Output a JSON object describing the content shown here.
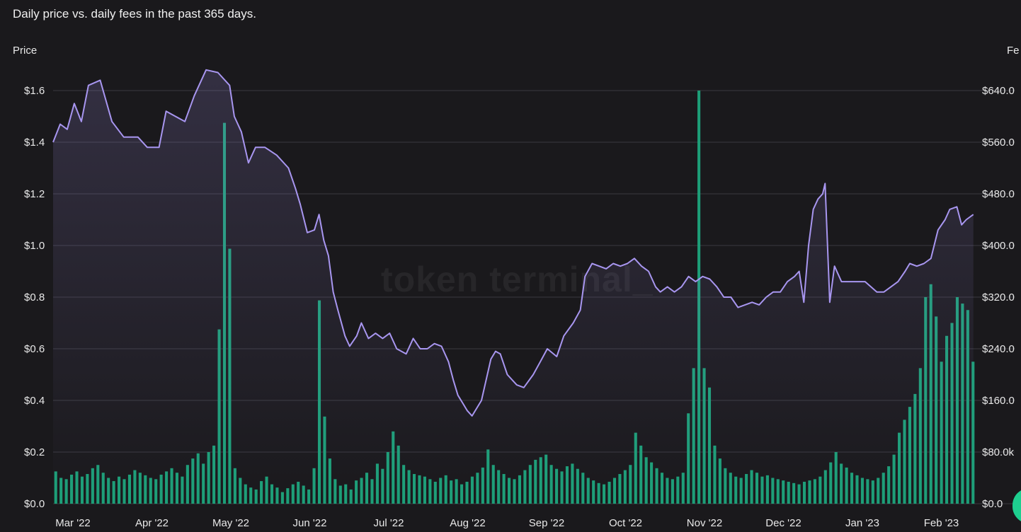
{
  "caption": "Daily price vs. daily fees in the past 365 days.",
  "watermark": "token terminal_",
  "colors": {
    "background": "#1a191c",
    "price_line": "#a896f0",
    "fee_bars": "#1d9e78",
    "grid": "#3a3940",
    "text": "#e8e8e8"
  },
  "chart_data": {
    "type": "line+bar",
    "title": "Daily price vs. daily fees in the past 365 days.",
    "x_tick_labels": [
      "Mar '22",
      "Apr '22",
      "May '22",
      "Jun '22",
      "Jul '22",
      "Aug '22",
      "Sep '22",
      "Oct '22",
      "Nov '22",
      "Dec '22",
      "Jan '23",
      "Feb '23"
    ],
    "left_axis": {
      "label": "Price",
      "ticks": [
        "$1.6",
        "$1.4",
        "$1.2",
        "$1.0",
        "$0.8",
        "$0.6",
        "$0.4",
        "$0.2",
        "$0.0"
      ],
      "ylim": [
        0,
        1.6
      ]
    },
    "right_axis": {
      "label": "Fe",
      "ticks": [
        "$640.0",
        "$560.0",
        "$480.0",
        "$400.0",
        "$320.0",
        "$240.0",
        "$160.0",
        "$80.0k",
        "$0.0"
      ],
      "ylim": [
        0,
        640
      ]
    },
    "grid": true,
    "series": [
      {
        "kind": "line",
        "axis": "left",
        "points": [
          [
            0,
            1.4
          ],
          [
            3,
            1.47
          ],
          [
            6,
            1.45
          ],
          [
            9,
            1.55
          ],
          [
            12,
            1.48
          ],
          [
            15,
            1.62
          ],
          [
            20,
            1.64
          ],
          [
            25,
            1.48
          ],
          [
            30,
            1.42
          ],
          [
            36,
            1.42
          ],
          [
            40,
            1.38
          ],
          [
            45,
            1.38
          ],
          [
            48,
            1.52
          ],
          [
            52,
            1.5
          ],
          [
            56,
            1.48
          ],
          [
            60,
            1.58
          ],
          [
            63,
            1.64
          ],
          [
            65,
            1.68
          ],
          [
            70,
            1.67
          ],
          [
            75,
            1.62
          ],
          [
            77,
            1.5
          ],
          [
            80,
            1.44
          ],
          [
            83,
            1.32
          ],
          [
            86,
            1.38
          ],
          [
            90,
            1.38
          ],
          [
            95,
            1.35
          ],
          [
            100,
            1.3
          ],
          [
            103,
            1.22
          ],
          [
            105,
            1.16
          ],
          [
            108,
            1.05
          ],
          [
            111,
            1.06
          ],
          [
            113,
            1.12
          ],
          [
            115,
            1.02
          ],
          [
            117,
            0.96
          ],
          [
            119,
            0.82
          ],
          [
            121,
            0.75
          ],
          [
            124,
            0.65
          ],
          [
            126,
            0.61
          ],
          [
            129,
            0.65
          ],
          [
            131,
            0.7
          ],
          [
            134,
            0.64
          ],
          [
            137,
            0.66
          ],
          [
            140,
            0.64
          ],
          [
            143,
            0.66
          ],
          [
            146,
            0.6
          ],
          [
            150,
            0.58
          ],
          [
            153,
            0.64
          ],
          [
            156,
            0.6
          ],
          [
            159,
            0.6
          ],
          [
            162,
            0.62
          ],
          [
            165,
            0.61
          ],
          [
            168,
            0.55
          ],
          [
            170,
            0.48
          ],
          [
            172,
            0.42
          ],
          [
            174,
            0.39
          ],
          [
            176,
            0.36
          ],
          [
            178,
            0.34
          ],
          [
            182,
            0.4
          ],
          [
            186,
            0.56
          ],
          [
            188,
            0.59
          ],
          [
            190,
            0.58
          ],
          [
            193,
            0.5
          ],
          [
            197,
            0.46
          ],
          [
            200,
            0.45
          ],
          [
            204,
            0.5
          ],
          [
            207,
            0.55
          ],
          [
            210,
            0.6
          ],
          [
            214,
            0.57
          ],
          [
            217,
            0.65
          ],
          [
            221,
            0.7
          ],
          [
            224,
            0.75
          ],
          [
            226,
            0.88
          ],
          [
            229,
            0.93
          ],
          [
            232,
            0.92
          ],
          [
            235,
            0.91
          ],
          [
            238,
            0.93
          ],
          [
            241,
            0.92
          ],
          [
            244,
            0.93
          ],
          [
            247,
            0.95
          ],
          [
            250,
            0.92
          ],
          [
            253,
            0.9
          ],
          [
            256,
            0.84
          ],
          [
            258,
            0.82
          ],
          [
            261,
            0.84
          ],
          [
            264,
            0.82
          ],
          [
            267,
            0.84
          ],
          [
            270,
            0.88
          ],
          [
            273,
            0.86
          ],
          [
            276,
            0.88
          ],
          [
            279,
            0.87
          ],
          [
            282,
            0.84
          ],
          [
            285,
            0.8
          ],
          [
            288,
            0.8
          ],
          [
            291,
            0.76
          ],
          [
            294,
            0.77
          ],
          [
            297,
            0.78
          ],
          [
            300,
            0.77
          ],
          [
            303,
            0.8
          ],
          [
            306,
            0.82
          ],
          [
            309,
            0.82
          ],
          [
            312,
            0.86
          ],
          [
            315,
            0.88
          ],
          [
            317,
            0.9
          ],
          [
            319,
            0.78
          ],
          [
            321,
            1.0
          ],
          [
            323,
            1.14
          ],
          [
            325,
            1.18
          ],
          [
            327,
            1.2
          ],
          [
            328,
            1.24
          ],
          [
            330,
            0.78
          ],
          [
            332,
            0.92
          ],
          [
            335,
            0.86
          ],
          [
            340,
            0.86
          ],
          [
            345,
            0.86
          ],
          [
            350,
            0.82
          ],
          [
            353,
            0.82
          ],
          [
            356,
            0.84
          ],
          [
            359,
            0.86
          ],
          [
            362,
            0.9
          ],
          [
            364,
            0.93
          ],
          [
            367,
            0.92
          ],
          [
            370,
            0.93
          ],
          [
            373,
            0.95
          ],
          [
            376,
            1.06
          ],
          [
            379,
            1.1
          ],
          [
            381,
            1.14
          ],
          [
            384,
            1.15
          ],
          [
            386,
            1.08
          ],
          [
            388,
            1.1
          ],
          [
            391,
            1.12
          ]
        ]
      },
      {
        "kind": "bar",
        "axis": "right",
        "description": "daily fees",
        "values_sample_k": [
          50,
          40,
          38,
          45,
          50,
          42,
          46,
          55,
          60,
          48,
          40,
          35,
          42,
          38,
          45,
          52,
          48,
          44,
          40,
          38,
          45,
          50,
          55,
          48,
          42,
          60,
          70,
          78,
          62,
          80,
          90,
          270,
          590,
          395,
          55,
          40,
          30,
          25,
          22,
          35,
          42,
          30,
          25,
          18,
          24,
          30,
          34,
          28,
          22,
          55,
          315,
          135,
          70,
          38,
          28,
          30,
          22,
          36,
          40,
          48,
          38,
          62,
          54,
          80,
          112,
          90,
          60,
          52,
          46,
          44,
          42,
          38,
          34,
          40,
          44,
          36,
          38,
          30,
          34,
          42,
          48,
          56,
          84,
          60,
          52,
          46,
          40,
          38,
          44,
          52,
          60,
          68,
          72,
          76,
          60,
          54,
          50,
          58,
          62,
          54,
          48,
          40,
          36,
          32,
          30,
          34,
          40,
          46,
          52,
          60,
          110,
          90,
          72,
          64,
          55,
          48,
          40,
          38,
          42,
          48,
          140,
          210,
          640,
          210,
          180,
          90,
          70,
          55,
          48,
          42,
          40,
          46,
          52,
          48,
          42,
          44,
          40,
          38,
          36,
          34,
          32,
          30,
          34,
          36,
          38,
          42,
          52,
          64,
          80,
          62,
          56,
          48,
          44,
          40,
          38,
          36,
          40,
          48,
          58,
          76,
          110,
          130,
          150,
          170,
          210,
          320,
          340,
          290,
          220,
          260,
          280,
          320,
          310,
          300,
          220
        ]
      }
    ]
  }
}
